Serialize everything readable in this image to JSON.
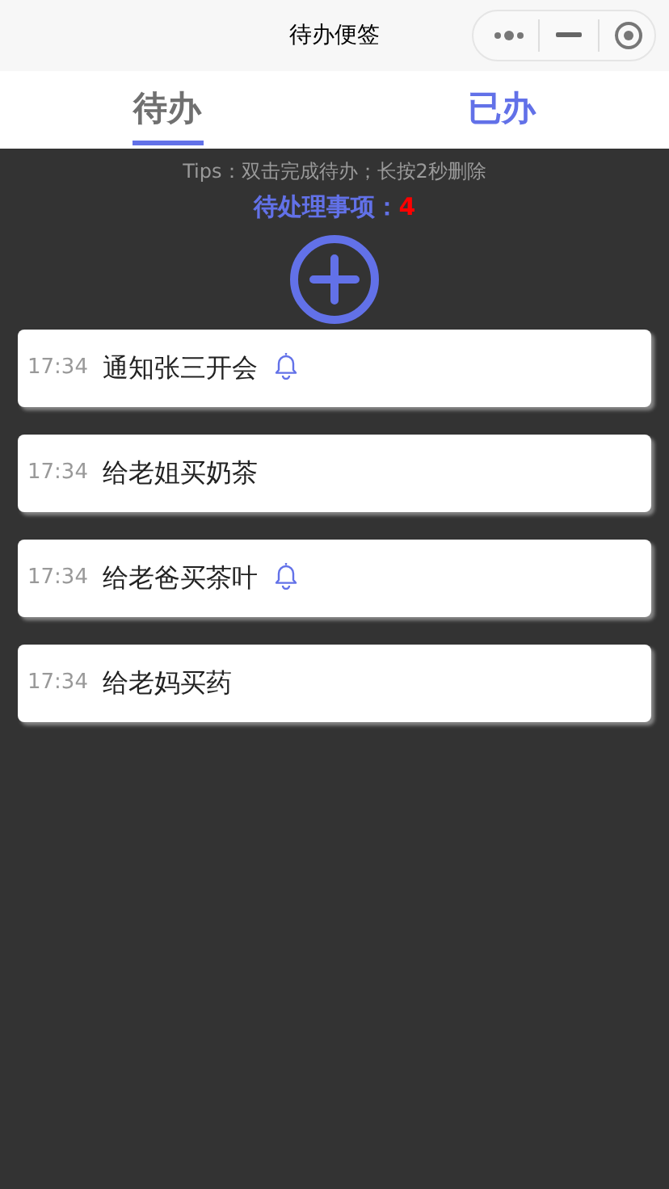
{
  "window": {
    "title": "待办便签"
  },
  "tabs": [
    {
      "label": "待办",
      "selected": true
    },
    {
      "label": "已办",
      "selected": false
    }
  ],
  "tips": "Tips：双击完成待办；长按2秒删除",
  "pending": {
    "label": "待处理事项：",
    "count": "4"
  },
  "todos": [
    {
      "time": "17:34",
      "text": "通知张三开会",
      "reminder": true
    },
    {
      "time": "17:34",
      "text": "给老姐买奶茶",
      "reminder": false
    },
    {
      "time": "17:34",
      "text": "给老爸买茶叶",
      "reminder": true
    },
    {
      "time": "17:34",
      "text": "给老妈买药",
      "reminder": false
    }
  ]
}
